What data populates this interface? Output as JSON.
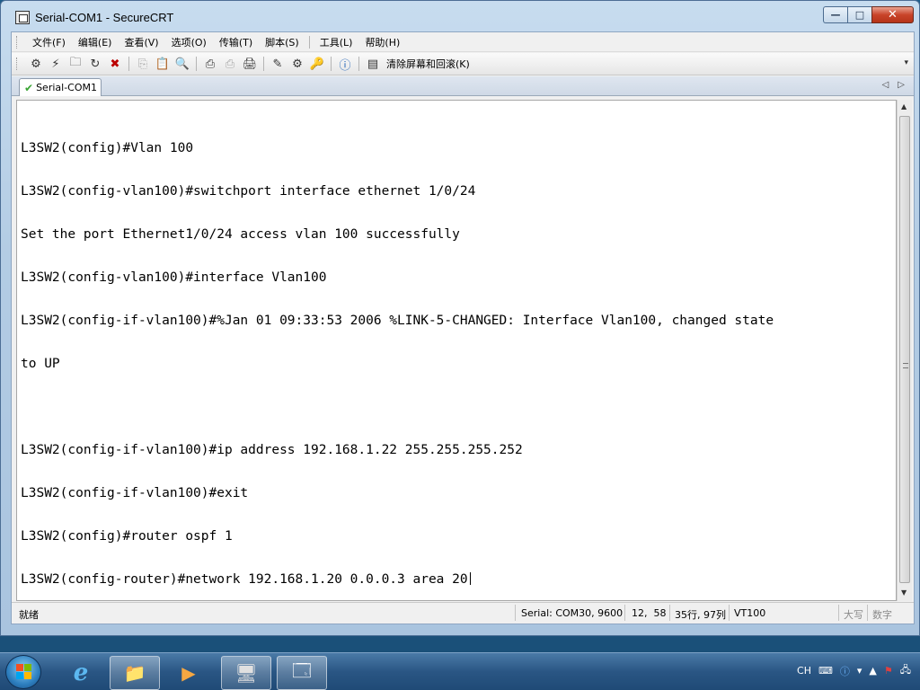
{
  "window": {
    "title": "Serial-COM1 - SecureCRT",
    "controls": {
      "minimize": "—",
      "maximize": "□",
      "close": "✕"
    }
  },
  "menu": {
    "items": [
      {
        "label": "文件(F)"
      },
      {
        "label": "编辑(E)"
      },
      {
        "label": "查看(V)"
      },
      {
        "label": "选项(O)"
      },
      {
        "label": "传输(T)"
      },
      {
        "label": "脚本(S)"
      },
      {
        "label": "工具(L)"
      },
      {
        "label": "帮助(H)"
      }
    ]
  },
  "toolbar": {
    "clear_label": "清除屏幕和回滚(K)",
    "overflow": "▾"
  },
  "tabs": [
    {
      "label": "Serial-COM1",
      "active": true
    }
  ],
  "tab_nav": {
    "prev": "◁",
    "next": "▷"
  },
  "terminal": {
    "lines": [
      "L3SW2(config)#Vlan 100",
      "L3SW2(config-vlan100)#switchport interface ethernet 1/0/24",
      "Set the port Ethernet1/0/24 access vlan 100 successfully",
      "L3SW2(config-vlan100)#interface Vlan100",
      "L3SW2(config-if-vlan100)#%Jan 01 09:33:53 2006 %LINK-5-CHANGED: Interface Vlan100, changed state",
      "to UP",
      "",
      "L3SW2(config-if-vlan100)#ip address 192.168.1.22 255.255.255.252",
      "L3SW2(config-if-vlan100)#exit",
      "L3SW2(config)#router ospf 1",
      "L3SW2(config-router)#network 192.168.1.20 0.0.0.3 area 20"
    ]
  },
  "status": {
    "ready": "就绪",
    "connection": "Serial: COM30, 9600",
    "cursor_pos": "12,  58",
    "size": "35行, 97列",
    "emulation": "VT100",
    "caps": "大写",
    "num": "数字"
  },
  "taskbar": {
    "tray_lang": "CH"
  }
}
